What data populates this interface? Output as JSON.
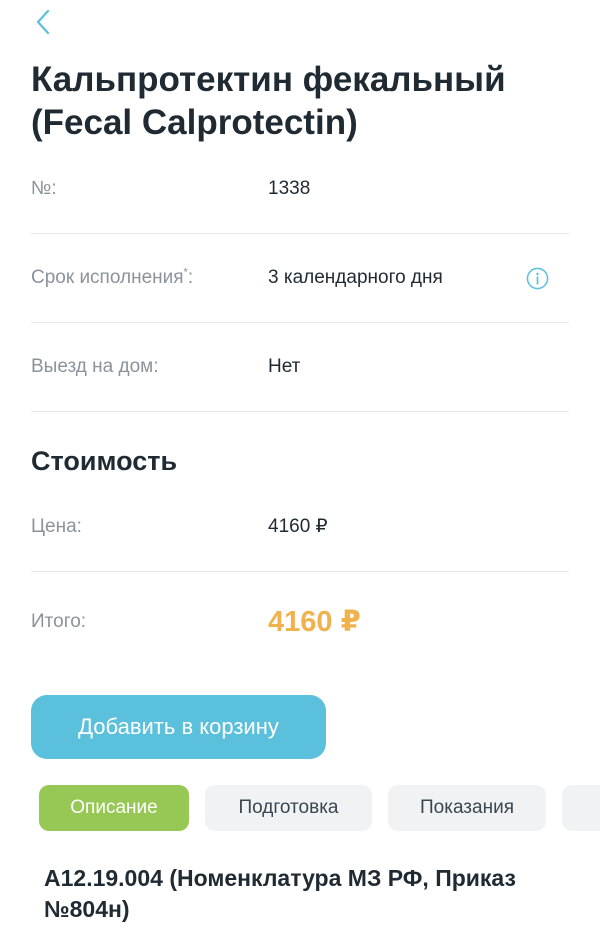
{
  "header": {
    "back_icon": "chevron-left-icon",
    "title": "Кальпротектин фекальный (Fecal Calprotectin)"
  },
  "details": {
    "number": {
      "label": "№:",
      "value": "1338"
    },
    "duration": {
      "label": "Срок исполнения",
      "label_mark": "*",
      "label_colon": ":",
      "value": "3 календарного дня",
      "info_icon": "info-icon"
    },
    "home_visit": {
      "label": "Выезд на дом:",
      "value": "Нет"
    }
  },
  "cost": {
    "title": "Стоимость",
    "price": {
      "label": "Цена:",
      "value": "4160 ₽"
    },
    "total": {
      "label": "Итого:",
      "value": "4160 ₽"
    }
  },
  "actions": {
    "add_to_cart": "Добавить в корзину"
  },
  "tabs": [
    {
      "label": "Описание",
      "active": true
    },
    {
      "label": "Подготовка",
      "active": false
    },
    {
      "label": "Показания",
      "active": false
    },
    {
      "label": "",
      "active": false
    }
  ],
  "description": {
    "code": "А12.19.004 (Номенклатура МЗ РФ, Приказ №804н)"
  },
  "colors": {
    "accent_blue": "#5bc0dc",
    "active_tab_green": "#97c754",
    "total_orange": "#f0b24d",
    "text_dark": "#1f2a33",
    "text_muted": "#8a939b"
  }
}
